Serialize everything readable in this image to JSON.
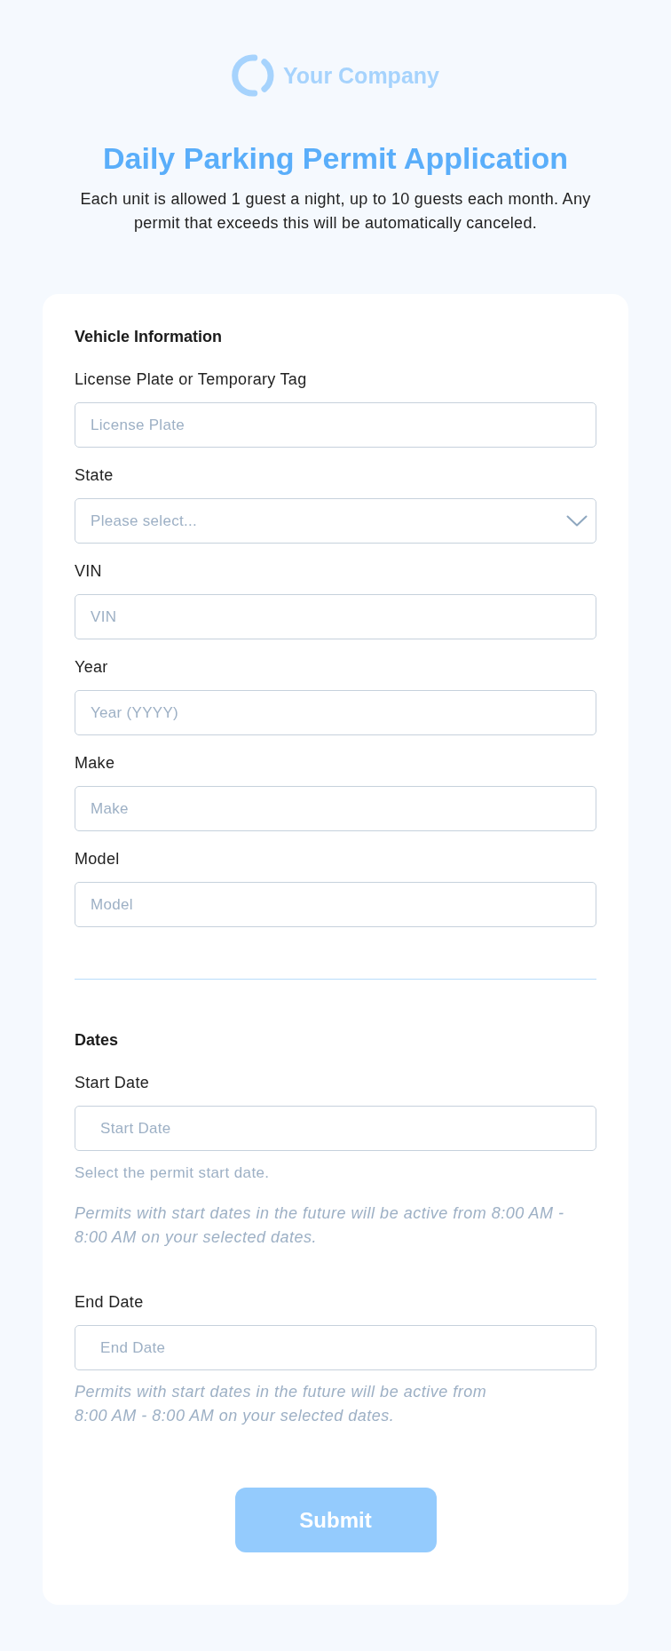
{
  "logo": {
    "text": "Your Company"
  },
  "header": {
    "title": "Daily Parking Permit Application",
    "subtitle": "Each unit is allowed 1 guest a night, up to 10 guests each month. Any permit that exceeds this will be automatically canceled."
  },
  "form": {
    "sections": [
      {
        "heading": "Vehicle Information",
        "fields": [
          {
            "kind": "text",
            "label": "License Plate or Temporary Tag",
            "placeholder": "License Plate"
          },
          {
            "kind": "select",
            "label": "State",
            "placeholder": "Please select..."
          },
          {
            "kind": "text",
            "label": "VIN",
            "placeholder": "VIN"
          },
          {
            "kind": "text",
            "label": "Year",
            "placeholder": "Year (YYYY)"
          },
          {
            "kind": "text",
            "label": "Make",
            "placeholder": "Make"
          },
          {
            "kind": "text",
            "label": "Model",
            "placeholder": "Model"
          }
        ]
      },
      {
        "heading": "Dates",
        "fields": [
          {
            "kind": "date",
            "label": "Start Date",
            "placeholder": "Start Date",
            "help": "Select the permit start date.",
            "note": "Permits with start dates in the future will be active from 8:00 AM - 8:00 AM on your selected dates."
          },
          {
            "kind": "date",
            "label": "End Date",
            "placeholder": "End Date",
            "note": "Permits with start dates in the future will be active from 8:00 AM - 8:00 AM on your selected dates."
          }
        ]
      }
    ]
  },
  "submit_button": {
    "label": "Submit"
  }
}
